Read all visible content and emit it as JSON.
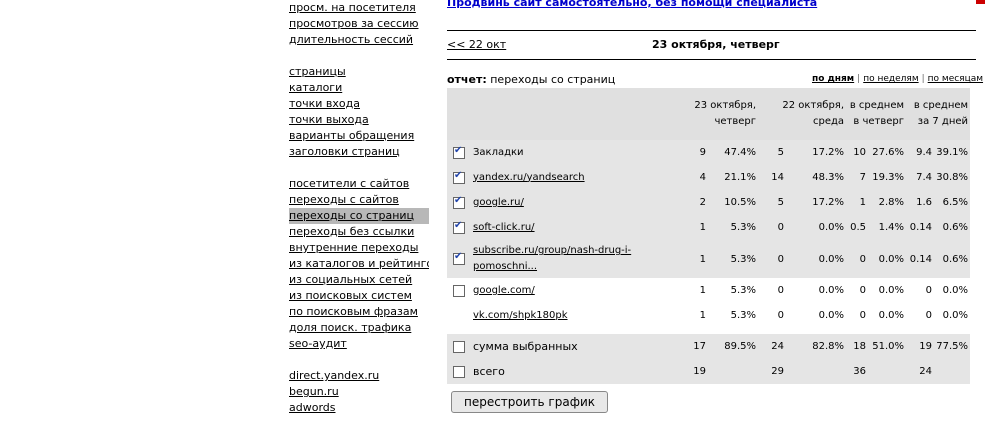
{
  "nav": {
    "group1": [
      "просм. на посетителя",
      "просмотров за сессию",
      "длительность сессий"
    ],
    "group2": [
      "страницы",
      "каталоги",
      "точки входа",
      "точки выхода",
      "варианты обращения",
      "заголовки страниц"
    ],
    "group3": [
      "посетители с сайтов",
      "переходы с сайтов",
      "переходы со страниц",
      "переходы без ссылки",
      "внутренние переходы",
      "из каталогов и рейтингов",
      "из социальных сетей",
      "из поисковых систем",
      "по поисковым фразам",
      "доля поиск. трафика",
      "seo-аудит"
    ],
    "group4": [
      "direct.yandex.ru",
      "begun.ru",
      "adwords"
    ]
  },
  "promo": "Продвинь сайт самостоятельно, без помощи специалиста",
  "date_nav": {
    "back": "<< 22 окт",
    "title": "23 октября, четверг"
  },
  "report": {
    "prefix": "отчет:",
    "name": "переходы со страниц"
  },
  "period": {
    "days": "по дням",
    "weeks": "по неделям",
    "months": "по месяцам"
  },
  "table": {
    "headers": {
      "col1": "23 октября, четверг",
      "col2": "22 октября, среда",
      "col3": "в среднем в четверг",
      "col4": "в среднем за 7 дней"
    },
    "rows": [
      {
        "label": "Закладки",
        "link": false,
        "checked": true,
        "has_cb": true,
        "v1": "9",
        "p1": "47.4%",
        "v2": "5",
        "p2": "17.2%",
        "v3": "10",
        "p3": "27.6%",
        "v4": "9.4",
        "p4": "39.1%"
      },
      {
        "label": "yandex.ru/yandsearch",
        "link": true,
        "checked": true,
        "has_cb": true,
        "v1": "4",
        "p1": "21.1%",
        "v2": "14",
        "p2": "48.3%",
        "v3": "7",
        "p3": "19.3%",
        "v4": "7.4",
        "p4": "30.8%"
      },
      {
        "label": "google.ru/",
        "link": true,
        "checked": true,
        "has_cb": true,
        "v1": "2",
        "p1": "10.5%",
        "v2": "5",
        "p2": "17.2%",
        "v3": "1",
        "p3": "2.8%",
        "v4": "1.6",
        "p4": "6.5%"
      },
      {
        "label": "soft-click.ru/",
        "link": true,
        "checked": true,
        "has_cb": true,
        "v1": "1",
        "p1": "5.3%",
        "v2": "0",
        "p2": "0.0%",
        "v3": "0.5",
        "p3": "1.4%",
        "v4": "0.14",
        "p4": "0.6%"
      },
      {
        "label": "subscribe.ru/group/nash-drug-i-pomoschni...",
        "link": true,
        "checked": true,
        "has_cb": true,
        "v1": "1",
        "p1": "5.3%",
        "v2": "0",
        "p2": "0.0%",
        "v3": "0",
        "p3": "0.0%",
        "v4": "0.14",
        "p4": "0.6%"
      },
      {
        "label": "google.com/",
        "link": true,
        "checked": false,
        "has_cb": true,
        "v1": "1",
        "p1": "5.3%",
        "v2": "0",
        "p2": "0.0%",
        "v3": "0",
        "p3": "0.0%",
        "v4": "0",
        "p4": "0.0%"
      },
      {
        "label": "vk.com/shpk180pk",
        "link": true,
        "checked": false,
        "has_cb": false,
        "v1": "1",
        "p1": "5.3%",
        "v2": "0",
        "p2": "0.0%",
        "v3": "0",
        "p3": "0.0%",
        "v4": "0",
        "p4": "0.0%"
      }
    ],
    "sum": {
      "label": "сумма выбранных",
      "v1": "17",
      "p1": "89.5%",
      "v2": "24",
      "p2": "82.8%",
      "v3": "18",
      "p3": "51.0%",
      "v4": "19",
      "p4": "77.5%"
    },
    "total": {
      "label": "всего",
      "v1": "19",
      "v2": "29",
      "v3": "36",
      "v4": "24"
    }
  },
  "rebuild_button": "перестроить график"
}
